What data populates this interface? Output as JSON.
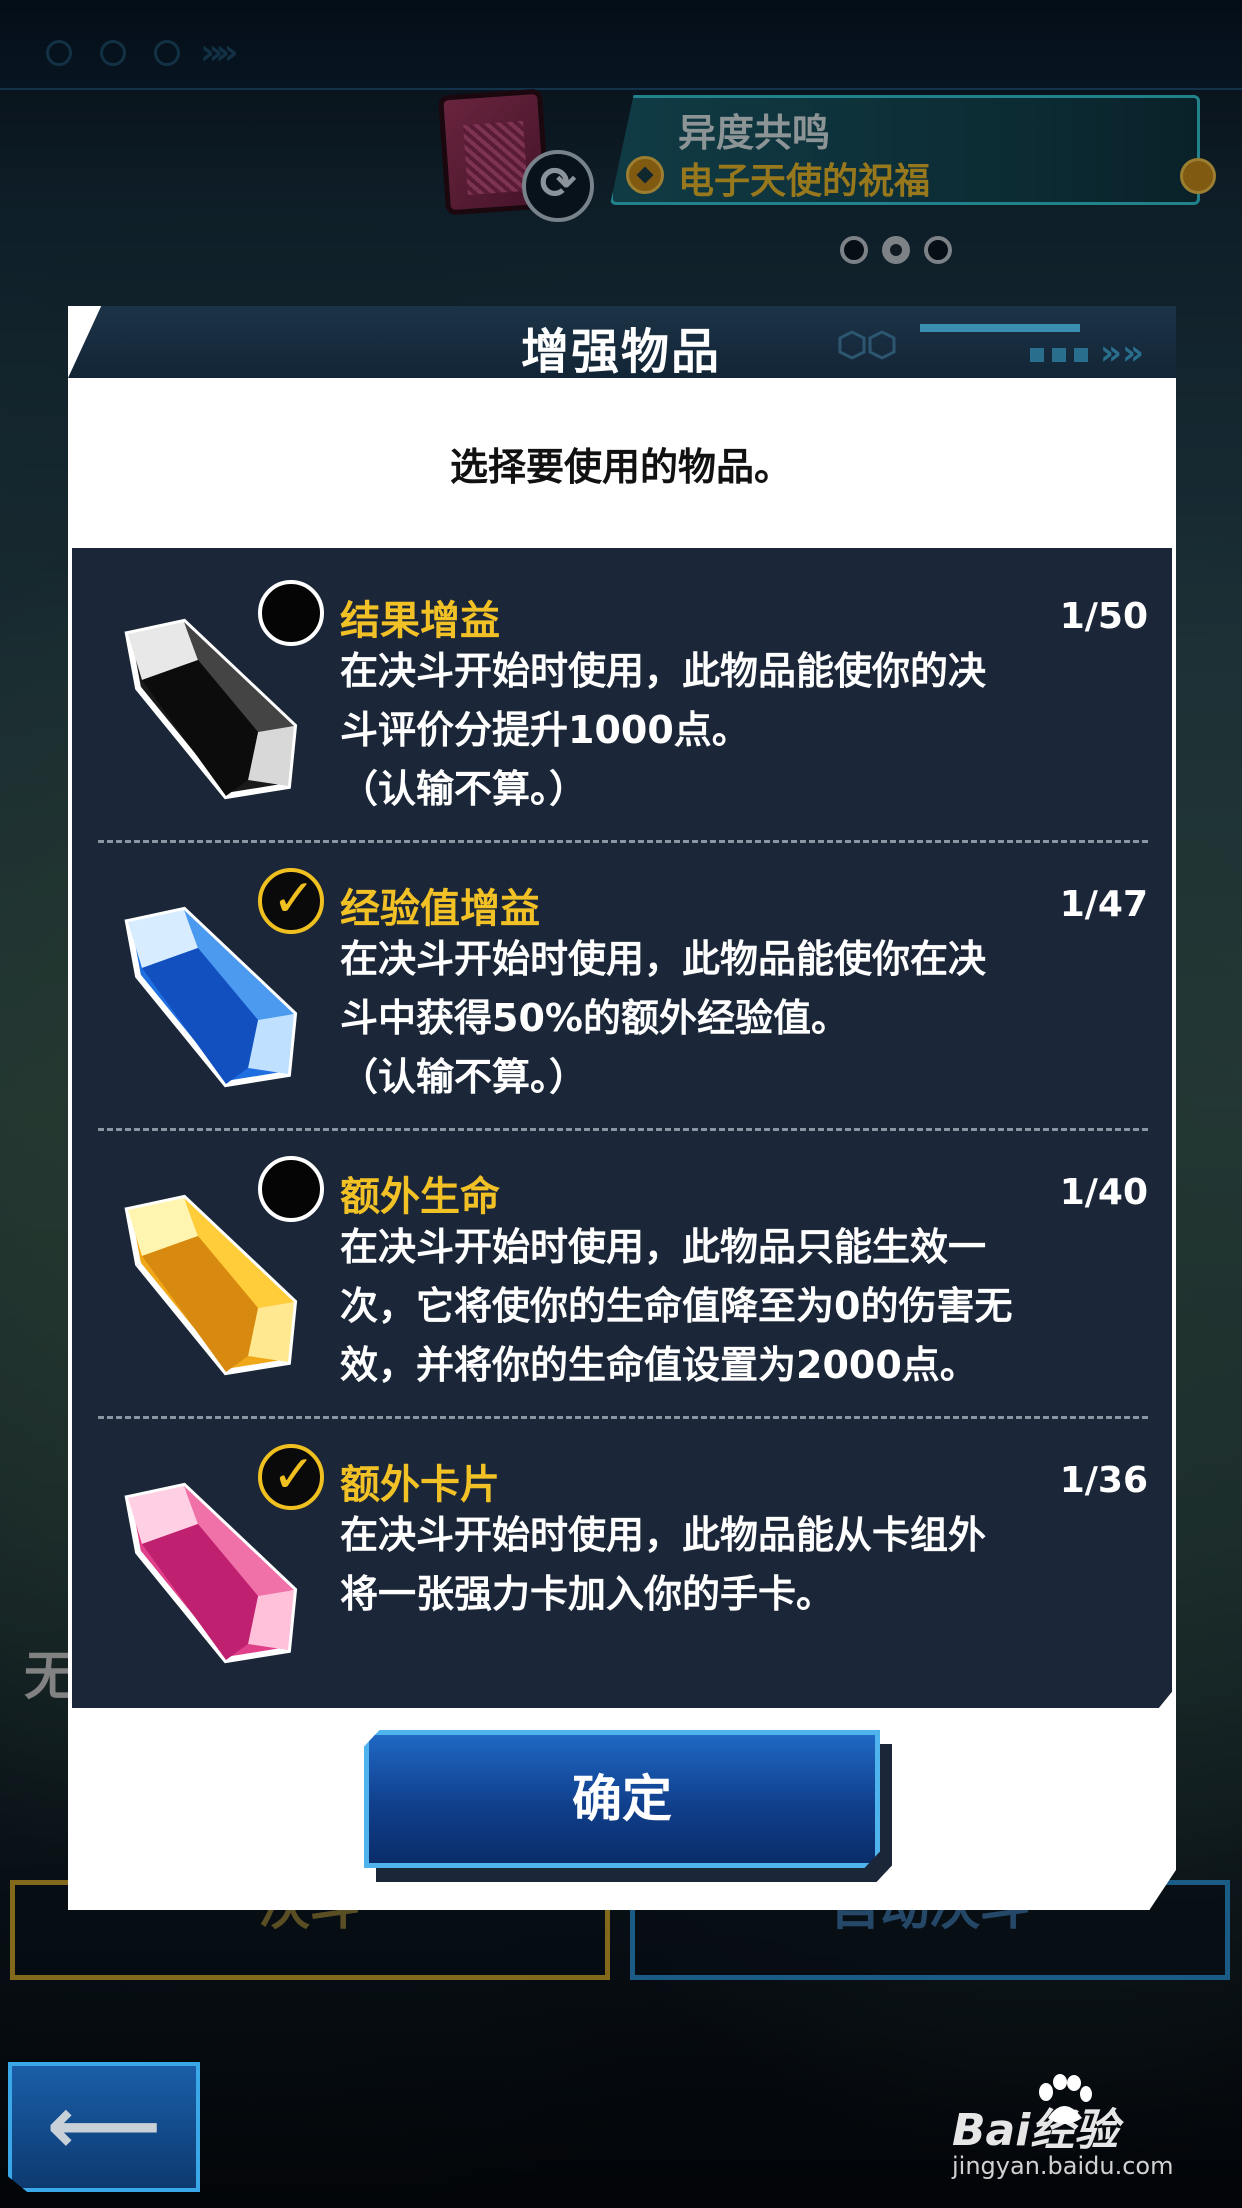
{
  "topbar": {
    "event_title": "异度共鸣",
    "event_subtitle": "电子天使的祝福"
  },
  "pager": {
    "count": 3,
    "active_index": 1
  },
  "dialog": {
    "title": "增强物品",
    "subtitle": "选择要使用的物品。",
    "confirm_label": "确定",
    "items": [
      {
        "name": "结果增益",
        "count": "1/50",
        "checked": false,
        "gem_color": "#2a2a2a",
        "description": "在决斗开始时使用，此物品能使你的决\n斗评价分提升1000点。\n（认输不算。）"
      },
      {
        "name": "经验值增益",
        "count": "1/47",
        "checked": true,
        "gem_color": "#1f6fe0",
        "description": "在决斗开始时使用，此物品能使你在决\n斗中获得50%的额外经验值。\n（认输不算。）"
      },
      {
        "name": "额外生命",
        "count": "1/40",
        "checked": false,
        "gem_color": "#f0a818",
        "description": "在决斗开始时使用，此物品只能生效一\n次，它将使你的生命值降至为0的伤害无\n效，并将你的生命值设置为2000点。"
      },
      {
        "name": "额外卡片",
        "count": "1/36",
        "checked": true,
        "gem_color": "#e0408a",
        "description": "在决斗开始时使用，此物品能从卡组外\n将一张强力卡加入你的手卡。"
      }
    ]
  },
  "background": {
    "left_label": "无",
    "duel_button": "决斗",
    "auto_duel_button": "自动决斗",
    "back_icon": "left-arrow-icon"
  },
  "watermark": {
    "brand": "Bai经验",
    "url": "jingyan.baidu.com"
  },
  "colors": {
    "accent_gold": "#f2c126",
    "panel_bg": "#1b2738",
    "confirm_blue": "#1f68c4"
  }
}
